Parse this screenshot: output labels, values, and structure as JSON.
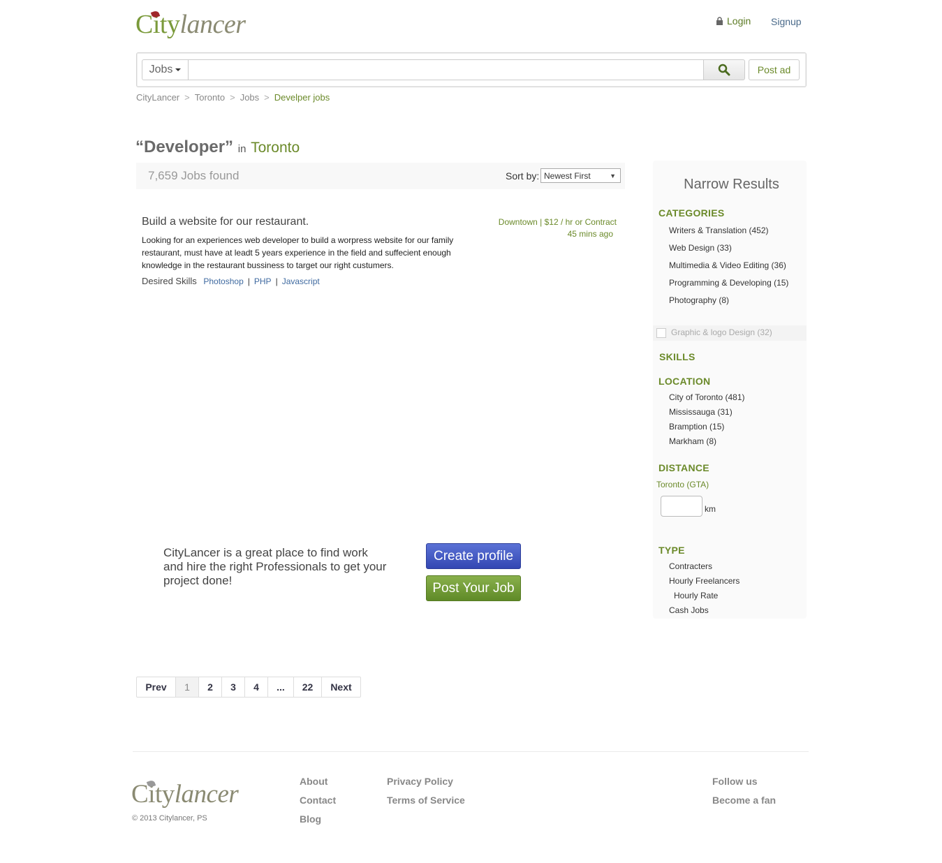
{
  "header": {
    "logo_city": "City",
    "logo_lancer": "lancer",
    "login": "Login",
    "signup": "Signup"
  },
  "search": {
    "category": "Jobs",
    "placeholder": "",
    "post_ad": "Post ad"
  },
  "breadcrumb": [
    "CityLancer",
    "Toronto",
    "Jobs",
    "Develper jobs"
  ],
  "results": {
    "query": "“Developer”",
    "in": "in",
    "city": "Toronto",
    "count": "7,659 Jobs found",
    "sort_label": "Sort by:",
    "sort_value": "Newest First"
  },
  "job": {
    "title": "Build a website for our restaurant.",
    "desc_lines": [
      "Looking for an experiences web developer to build a worpress website for our family",
      "restaurant, must have at leadt 5 years experience in the field and suffecient enough",
      "knowledge in the restaurant bussiness to target our right custumers."
    ],
    "meta": "Downtown | $12 / hr or Contract",
    "time": "45 mins ago",
    "skills_label": "Desired Skills",
    "skills": [
      "Photoshop",
      "PHP",
      "Javascript"
    ],
    "skill_sep": "|"
  },
  "promo": {
    "lines": [
      "CityLancer is a great place to find work",
      "and hire the right Professionals to get your",
      "project done!"
    ],
    "create_profile": "Create profile",
    "post_job": "Post Your Job"
  },
  "pagination": {
    "prev": "Prev",
    "pages": [
      "1",
      "2",
      "3",
      "4",
      "...",
      "22"
    ],
    "next": "Next",
    "current": "1"
  },
  "sidebar": {
    "title": "Narrow Results",
    "categories_h": "CATEGORIES",
    "categories": [
      "Writers & Translation (452)",
      "Web Design (33)",
      "Multimedia & Video Editing (36)",
      "Programming & Developing (15)",
      "Photography (8)"
    ],
    "dim_category": "Graphic & logo Design (32)",
    "skills_h": "SKILLS",
    "location_h": "LOCATION",
    "locations": [
      "City of Toronto (481)",
      "Mississauga (31)",
      "Bramption (15)",
      "Markham (8)"
    ],
    "distance_h": "DISTANCE",
    "distance_place": "Toronto (GTA)",
    "km": "km",
    "type_h": "TYPE",
    "types": [
      "Contracters",
      "Hourly Freelancers",
      "Hourly Rate",
      "Cash Jobs"
    ]
  },
  "footer": {
    "logo_city": "City",
    "logo_lancer": "lancer",
    "copyright": "© 2013 Citylancer, PS",
    "col1": [
      "About",
      "Contact",
      "Blog"
    ],
    "col2": [
      "Privacy Policy",
      "Terms of Service"
    ],
    "col3": [
      "Follow us",
      "Become a fan"
    ]
  },
  "colors": {
    "brand_green": "#6b8a2a",
    "link_blue": "#3f6aa0",
    "button_blue": "#3f55c2",
    "button_green": "#6f9a33"
  },
  "icons": [
    "maple-leaf-icon",
    "lock-icon",
    "caret-down-icon",
    "search-icon"
  ]
}
